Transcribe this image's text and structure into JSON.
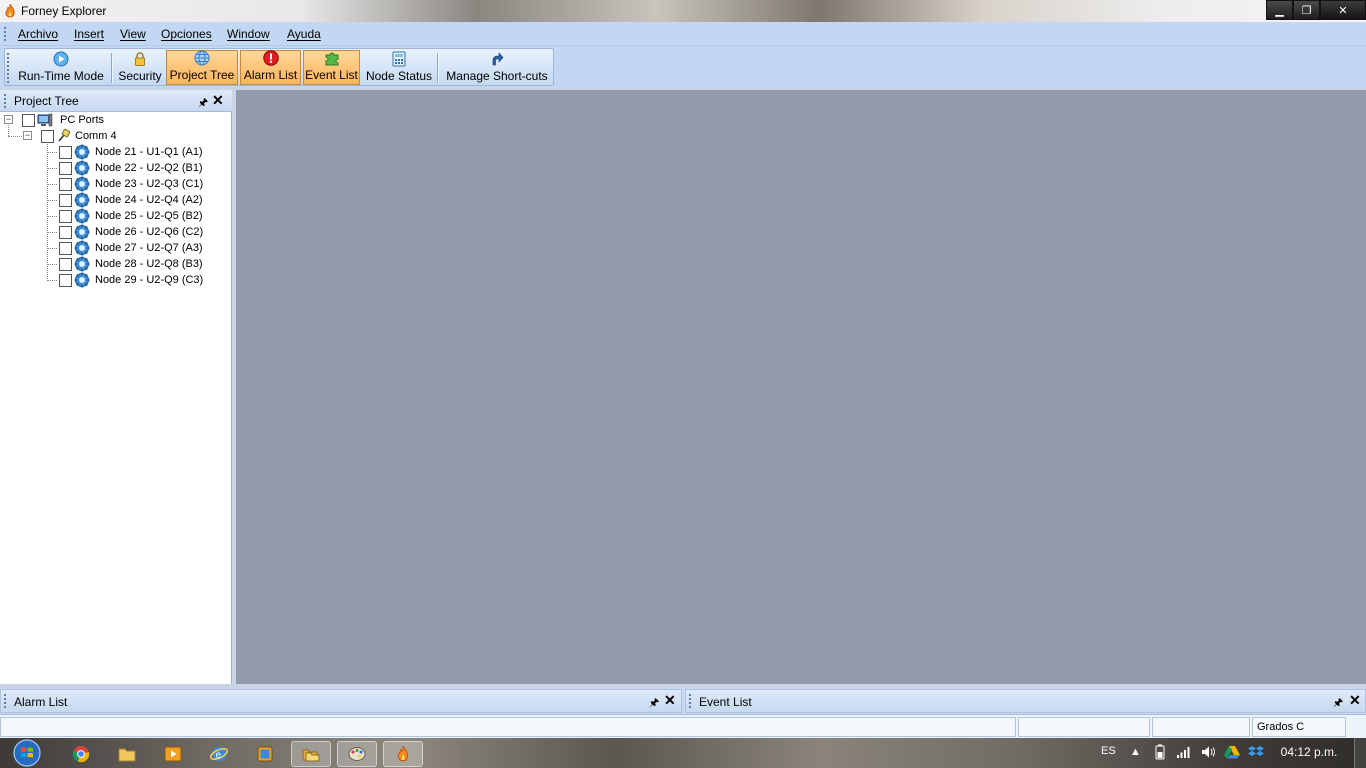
{
  "window": {
    "title": "Forney Explorer"
  },
  "menu": [
    "Archivo",
    "Insert",
    "View",
    "Opciones",
    "Window",
    "Ayuda"
  ],
  "toolbar": {
    "buttons": [
      {
        "label": "Run-Time Mode",
        "icon": "play-icon",
        "active": false
      },
      {
        "label": "Security",
        "icon": "lock-icon",
        "active": false
      },
      {
        "label": "Project Tree",
        "icon": "globe-icon",
        "active": true
      },
      {
        "label": "Alarm List",
        "icon": "alarm-icon",
        "active": true
      },
      {
        "label": "Event List",
        "icon": "puzzle-icon",
        "active": true
      },
      {
        "label": "Node Status",
        "icon": "calculator-icon",
        "active": false
      },
      {
        "label": "Manage Short-cuts",
        "icon": "shortcut-arrow-icon",
        "active": false
      }
    ]
  },
  "project_tree": {
    "title": "Project Tree",
    "root": {
      "label": "PC Ports"
    },
    "port": {
      "label": "Comm 4"
    },
    "nodes": [
      "Node 21 - U1-Q1 (A1)",
      "Node 22 - U2-Q2 (B1)",
      "Node 23 - U2-Q3 (C1)",
      "Node 24 - U2-Q4 (A2)",
      "Node 25 - U2-Q5 (B2)",
      "Node 26 - U2-Q6 (C2)",
      "Node 27 - U2-Q7 (A3)",
      "Node 28 - U2-Q8 (B3)",
      "Node 29 - U2-Q9 (C3)"
    ]
  },
  "bottom_panels": {
    "alarm_list": "Alarm List",
    "event_list": "Event List"
  },
  "statusbar": {
    "units": "Grados C"
  },
  "taskbar": {
    "language": "ES",
    "clock": "04:12 p.m."
  },
  "colors": {
    "menu_bg": "#c2d8f2",
    "active_button": "#ffc074",
    "mdi_bg": "#9299ad"
  }
}
